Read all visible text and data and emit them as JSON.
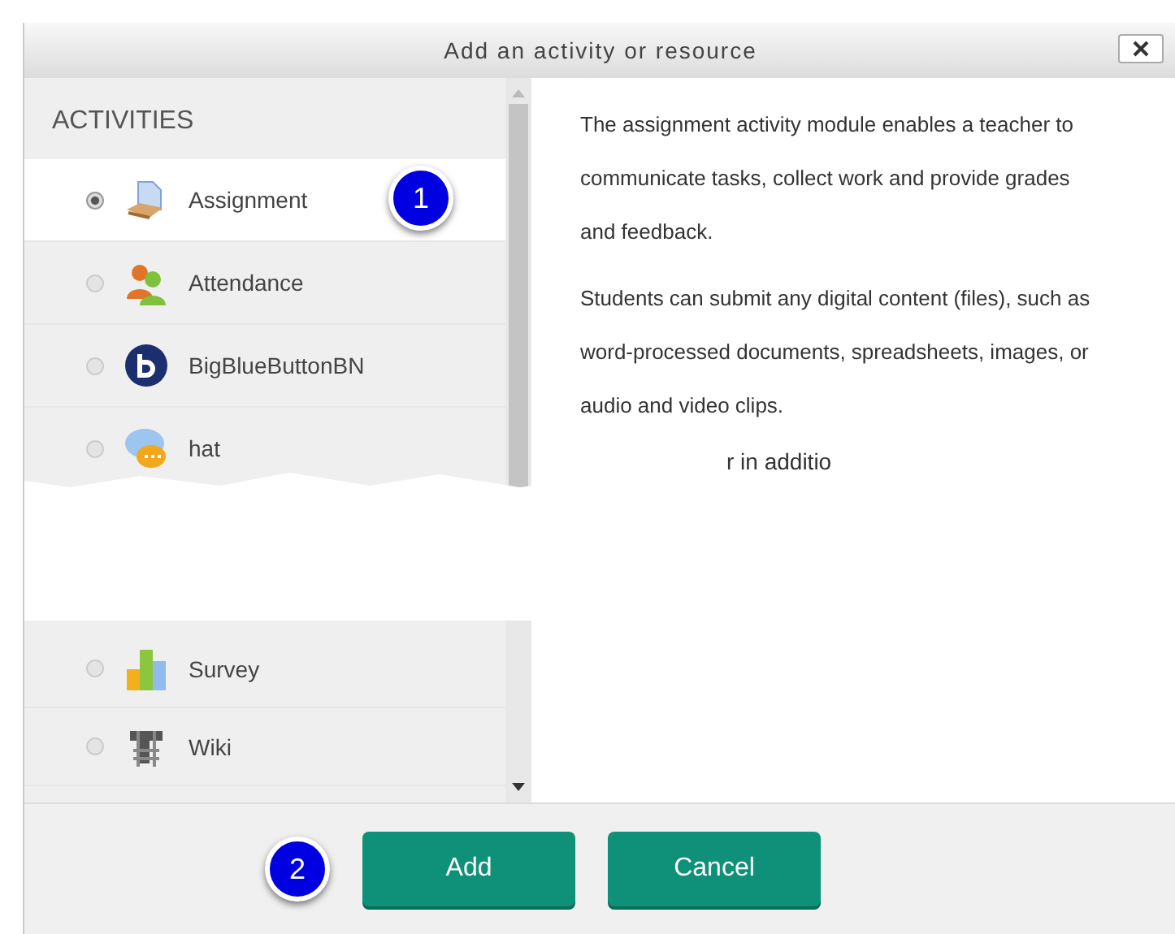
{
  "dialog": {
    "title": "Add an activity or resource"
  },
  "section_heading": "ACTIVITIES",
  "top_items": [
    {
      "label": "Assignment",
      "kind": "assignment",
      "selected": true,
      "callout": "1"
    },
    {
      "label": "Attendance",
      "kind": "attendance",
      "selected": false
    },
    {
      "label": "BigBlueButtonBN",
      "kind": "conference",
      "selected": false
    },
    {
      "label": "hat",
      "kind": "chat",
      "selected": false
    }
  ],
  "description": [
    {
      "kind": "paragraph",
      "text": "The assignment activity module enables a teacher to communicate tasks, collect work and provide grades and feedback."
    },
    {
      "kind": "paragraph",
      "text": "Students can submit any digital content (files), such as word-processed documents, spreadsheets, images, or audio and video clips."
    },
    {
      "kind": "fragment",
      "text": "r in additio"
    }
  ],
  "bottom_items": [
    {
      "label": "Survey",
      "kind": "survey",
      "selected": false
    },
    {
      "label": "Wiki",
      "kind": "wiki",
      "selected": false
    }
  ],
  "footer": {
    "callout": "2",
    "buttons": [
      {
        "label": "Add"
      },
      {
        "label": "Cancel"
      }
    ]
  }
}
